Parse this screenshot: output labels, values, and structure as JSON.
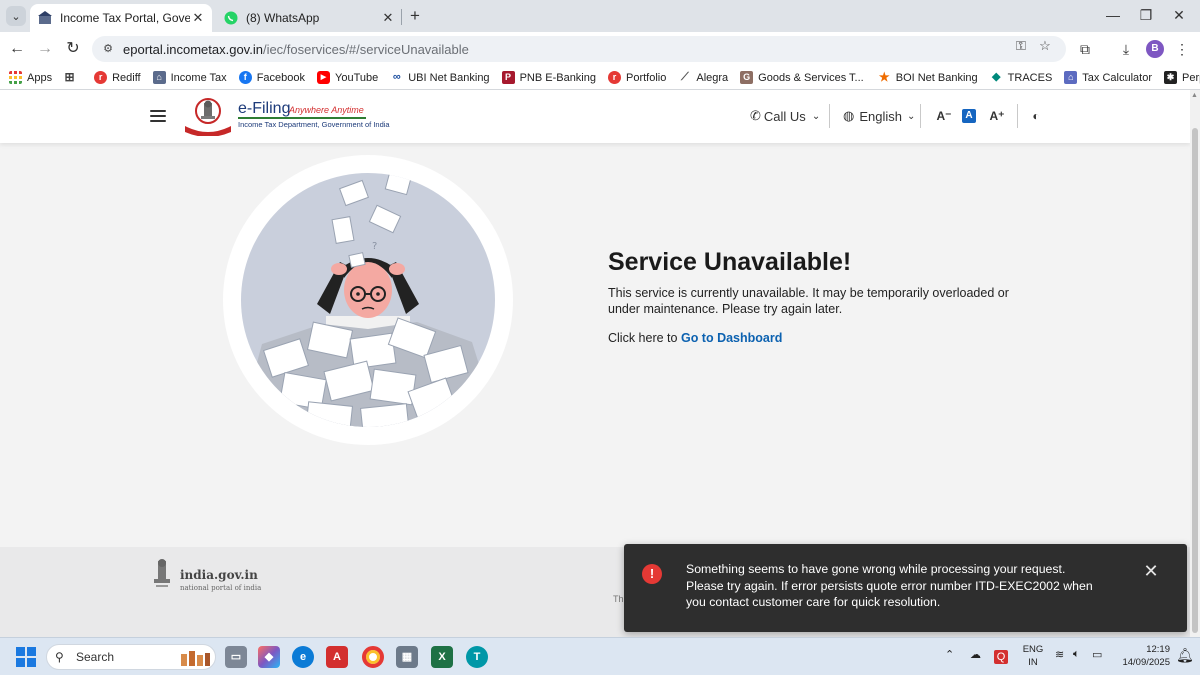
{
  "browser": {
    "tabs": [
      {
        "title": "Income Tax Portal, Government",
        "active": true
      },
      {
        "title": "(8) WhatsApp",
        "active": false
      }
    ],
    "url": {
      "host": "eportal.incometax.gov.in",
      "path": "/iec/foservices/#/serviceUnavailable"
    },
    "profile_initial": "B",
    "bookmarks": [
      {
        "label": "Apps",
        "icon": "apps-grid-icon",
        "color": "#e53935"
      },
      {
        "label": "",
        "icon": "tab-groups-icon",
        "color": "#444444"
      },
      {
        "label": "Rediff",
        "icon": "rediff-icon",
        "color": "#e53935"
      },
      {
        "label": "Income Tax",
        "icon": "income-tax-icon",
        "color": "#1d3b7a"
      },
      {
        "label": "Facebook",
        "icon": "facebook-icon",
        "color": "#1877f2"
      },
      {
        "label": "YouTube",
        "icon": "youtube-icon",
        "color": "#ff0000"
      },
      {
        "label": "UBI Net Banking",
        "icon": "ubi-icon",
        "color": "#1d4fa0"
      },
      {
        "label": "PNB E-Banking",
        "icon": "pnb-icon",
        "color": "#a6192e"
      },
      {
        "label": "Portfolio",
        "icon": "rediff-icon",
        "color": "#e53935"
      },
      {
        "label": "Alegra",
        "icon": "alegra-icon",
        "color": "#555555"
      },
      {
        "label": "Goods & Services T...",
        "icon": "gst-icon",
        "color": "#8d6e63"
      },
      {
        "label": "BOI Net Banking",
        "icon": "boi-star-icon",
        "color": "#ef6c00"
      },
      {
        "label": "TRACES",
        "icon": "traces-icon",
        "color": "#00897b"
      },
      {
        "label": "Tax Calculator",
        "icon": "tax-calculator-icon",
        "color": "#5c6bc0"
      },
      {
        "label": "PerplexityAI",
        "icon": "perplexity-icon",
        "color": "#222222"
      }
    ]
  },
  "site": {
    "logo": {
      "brand": "e-Filing",
      "tagline": "Anywhere Anytime",
      "dept": "Income Tax Department, Government of India"
    },
    "header": {
      "call_us": "Call Us",
      "language": "English"
    }
  },
  "content": {
    "title": "Service Unavailable!",
    "body": "This service is currently unavailable. It may be temporarily overloaded or under maintenance. Please try again later.",
    "link_prefix": "Click here to",
    "link_text": "Go to Dashboard"
  },
  "footer": {
    "portal_name": "india.gov.in",
    "portal_sub": "national portal of india",
    "fragment": "Th"
  },
  "toast": {
    "message": "Something seems to have gone wrong while processing your request. Please try again. If error persists quote error number ITD-EXEC2002 when you contact customer care for quick resolution."
  },
  "taskbar": {
    "search_label": "Search",
    "lang_line1": "ENG",
    "lang_line2": "IN",
    "time": "12:19",
    "date": "14/09/2025"
  },
  "colors": {
    "link": "#0b61b0",
    "error": "#e53935",
    "toast_bg": "#2e2e2e"
  }
}
